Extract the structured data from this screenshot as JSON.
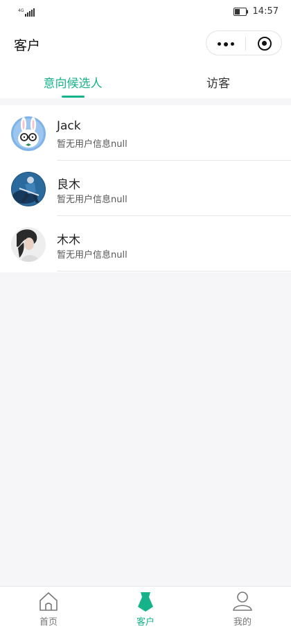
{
  "status_bar": {
    "network": "4G",
    "time": "14:57"
  },
  "nav": {
    "title": "客户"
  },
  "tabs": [
    {
      "label": "意向候选人",
      "active": true
    },
    {
      "label": "访客",
      "active": false
    }
  ],
  "customers": [
    {
      "name": "Jack",
      "info": "暂无用户信息null"
    },
    {
      "name": "良木",
      "info": "暂无用户信息null"
    },
    {
      "name": "木木",
      "info": "暂无用户信息null"
    }
  ],
  "tabbar": {
    "items": [
      {
        "label": "首页",
        "icon": "home-icon",
        "active": false
      },
      {
        "label": "客户",
        "icon": "customer-icon",
        "active": true
      },
      {
        "label": "我的",
        "icon": "profile-icon",
        "active": false
      }
    ]
  },
  "colors": {
    "accent": "#16b38a",
    "background": "#f6f6f9"
  }
}
